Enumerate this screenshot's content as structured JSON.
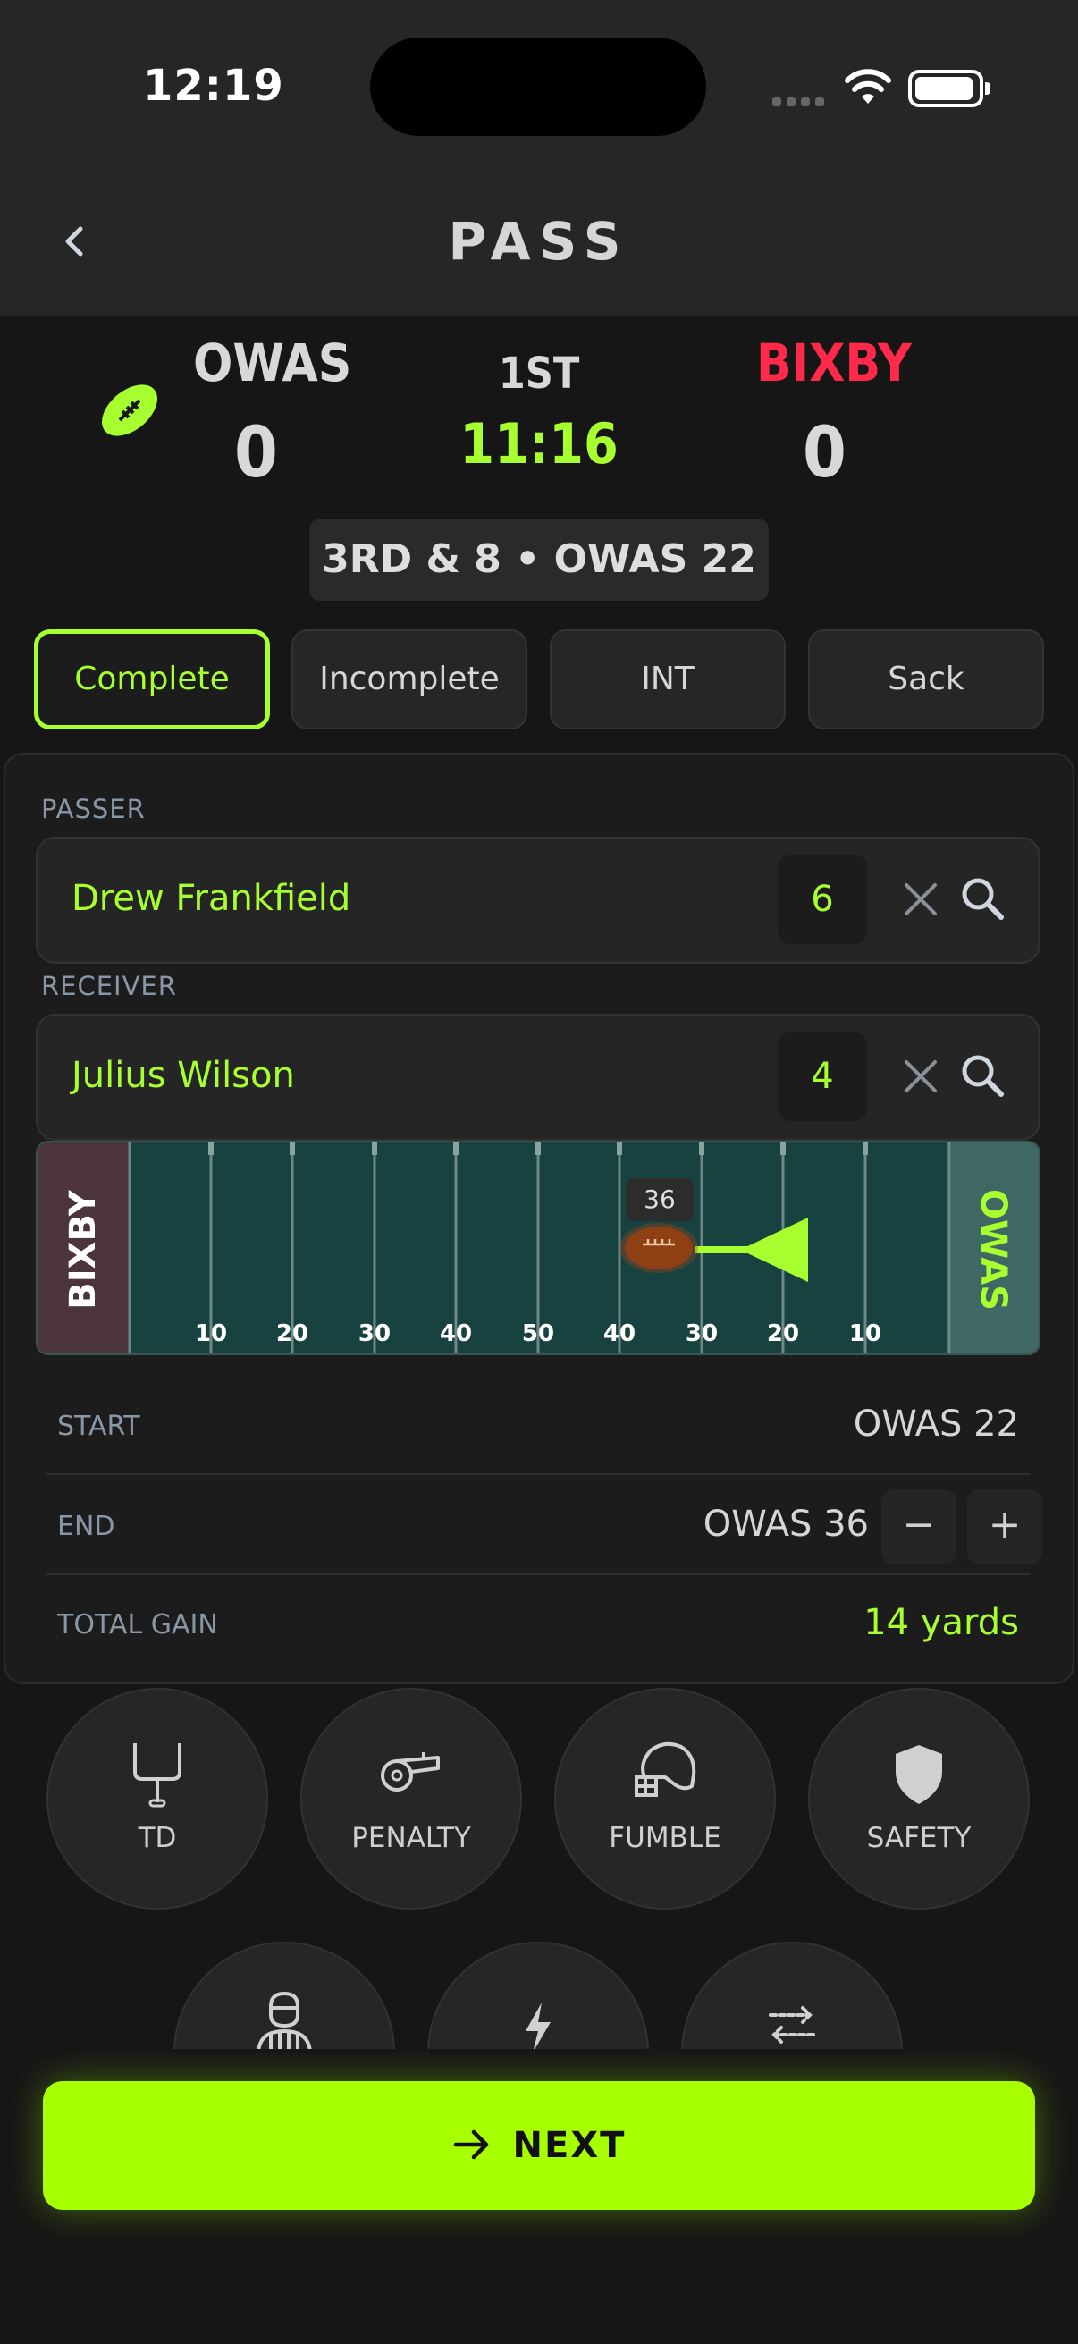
{
  "status_bar": {
    "time": "12:19"
  },
  "nav": {
    "title": "PASS"
  },
  "scoreboard": {
    "home": {
      "name": "OWAS",
      "score": "0"
    },
    "away": {
      "name": "BIXBY",
      "score": "0",
      "color": "#ff2a4a"
    },
    "period": "1ST",
    "clock": "11:16",
    "down_distance": "3RD & 8 • OWAS 22"
  },
  "result_tabs": [
    {
      "label": "Complete",
      "active": true
    },
    {
      "label": "Incomplete",
      "active": false
    },
    {
      "label": "INT",
      "active": false
    },
    {
      "label": "Sack",
      "active": false
    }
  ],
  "passer": {
    "label": "PASSER",
    "name": "Drew Frankfield",
    "number": "6"
  },
  "receiver": {
    "label": "RECEIVER",
    "name": "Julius Wilson",
    "number": "4"
  },
  "field": {
    "left_endzone": "BIXBY",
    "right_endzone": "OWAS",
    "yard_labels": [
      "10",
      "20",
      "30",
      "40",
      "50",
      "40",
      "30",
      "20",
      "10"
    ],
    "ball_marker": "36"
  },
  "play": {
    "start_label": "START",
    "start_value": "OWAS 22",
    "end_label": "END",
    "end_value": "OWAS 36",
    "minus": "−",
    "plus": "+",
    "gain_label": "TOTAL GAIN",
    "gain_value": "14 yards"
  },
  "actions": [
    {
      "label": "TD",
      "icon": "goalpost-icon"
    },
    {
      "label": "PENALTY",
      "icon": "whistle-icon"
    },
    {
      "label": "FUMBLE",
      "icon": "helmet-icon"
    },
    {
      "label": "SAFETY",
      "icon": "shield-icon"
    },
    {
      "label": "",
      "icon": "referee-icon"
    },
    {
      "label": "",
      "icon": "lightning-icon"
    },
    {
      "label": "",
      "icon": "swap-icon"
    }
  ],
  "next_button": {
    "label": "NEXT"
  },
  "colors": {
    "accent": "#a8ff2f",
    "away": "#ff2a4a",
    "field": "#17423f"
  }
}
